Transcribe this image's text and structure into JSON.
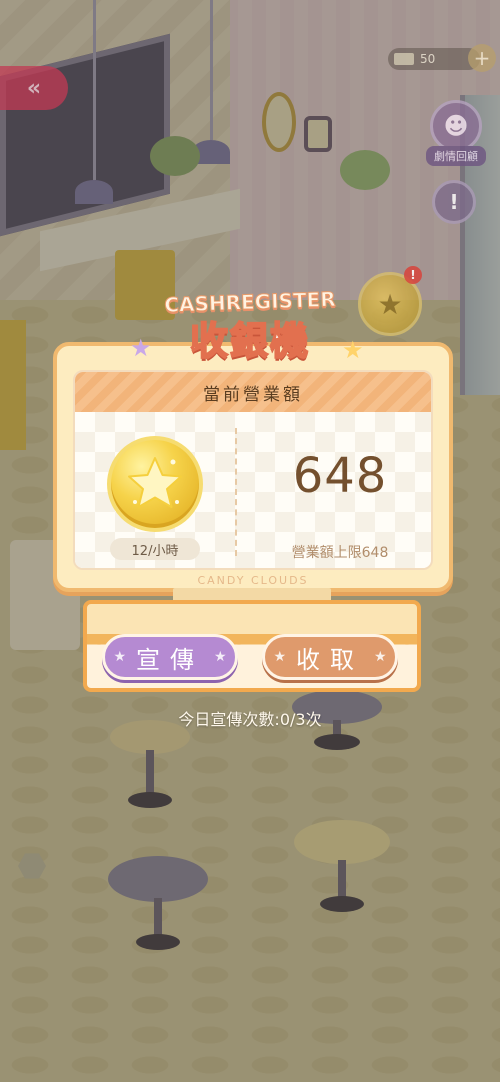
{
  "hud": {
    "back_glyph": "«",
    "tickets": "50",
    "plus_glyph": "+",
    "story_label": "劇情回顧",
    "notice_glyph": "!",
    "alert_glyph": "!"
  },
  "cash_register": {
    "title_en": "CASHREGISTER",
    "title_zh": "收銀機",
    "header": "當前營業額",
    "rate": "12/小時",
    "amount": "648",
    "limit": "營業額上限648",
    "brand": "CANDY CLOUDS",
    "promote_label": "宣傳",
    "collect_label": "收取",
    "promo_count": "今日宣傳次數:0/3次"
  },
  "colors": {
    "promote": "#b58ad2",
    "collect": "#df9a6c",
    "panel": "#fdecc0",
    "amount_text": "#74502e"
  }
}
